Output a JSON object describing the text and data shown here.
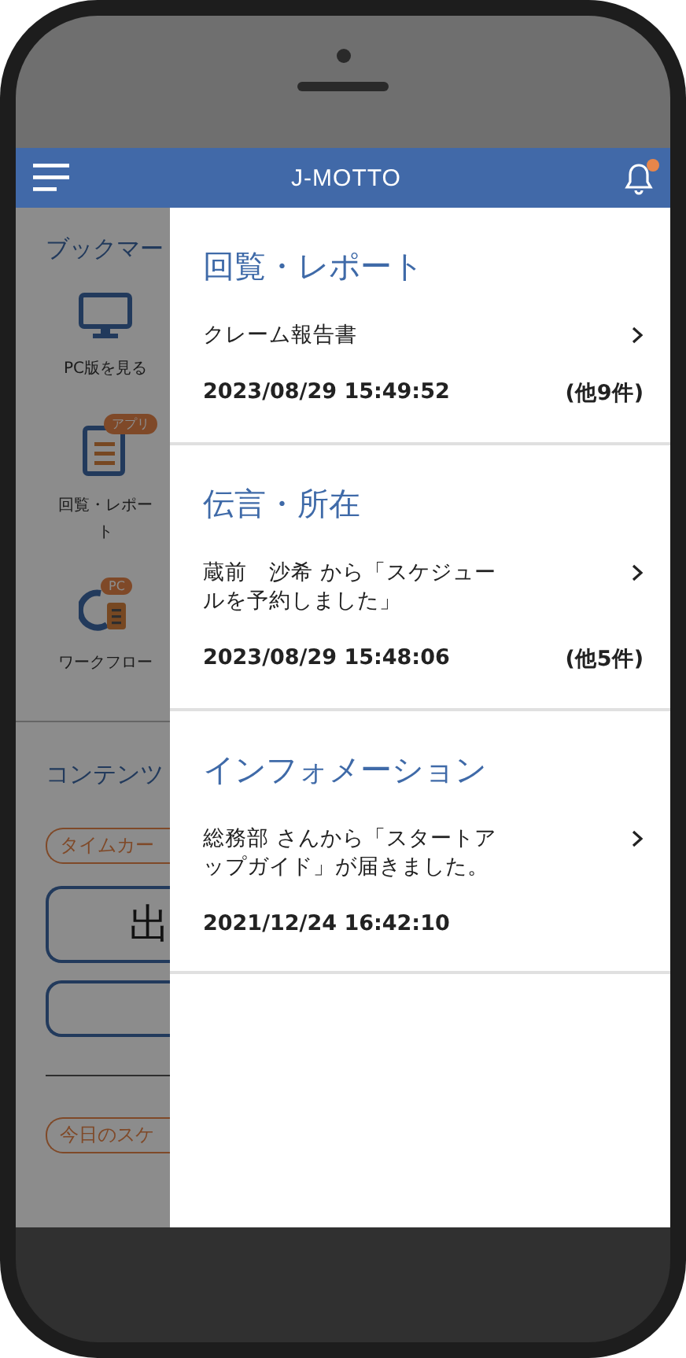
{
  "header": {
    "title": "J-MOTTO",
    "notification_dot": true
  },
  "background": {
    "bookmark_heading": "ブックマー",
    "bookmarks": [
      {
        "kind": "monitor",
        "label": "PC版を見る"
      },
      {
        "kind": "report",
        "label": "回覧・レポート",
        "badge": "アプリ"
      },
      {
        "kind": "workflow",
        "label": "ワークフロー",
        "badge": "PC"
      }
    ],
    "contents_heading": "コンテンツ",
    "timecard_tag": "タイムカー",
    "clock_in_button": "出",
    "schedule_tag": "今日のスケ"
  },
  "panel": {
    "sections": [
      {
        "title": "回覧・レポート",
        "message": "クレーム報告書",
        "date": "2023/08/29 15:49:52",
        "count": "(他9件)"
      },
      {
        "title": "伝言・所在",
        "message": "蔵前　沙希 から「スケジュールを予約しました」",
        "date": "2023/08/29 15:48:06",
        "count": "(他5件)"
      },
      {
        "title": "インフォメーション",
        "message": "総務部 さんから「スタートアップガイド」が届きました。",
        "date": "2021/12/24 16:42:10"
      }
    ]
  }
}
